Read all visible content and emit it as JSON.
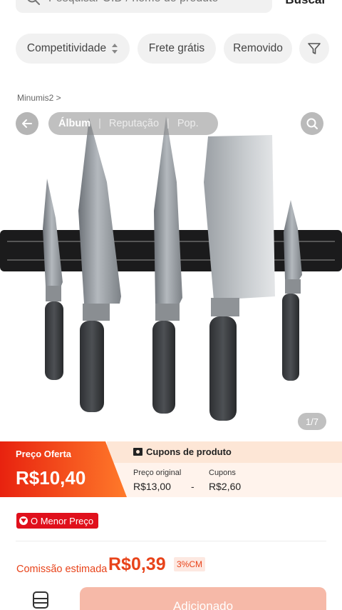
{
  "search": {
    "placeholder": "Pesquisar OID / nome do produto",
    "button_label": "Buscar"
  },
  "filters": {
    "chips": [
      {
        "label": "Competitividade",
        "icon": "sort-updown-icon"
      },
      {
        "label": "Frete grátis"
      },
      {
        "label": "Removido"
      }
    ],
    "filter_icon": "filter-funnel-icon"
  },
  "background_text": "Minumis2 >",
  "gallery": {
    "tabs": [
      "Álbum",
      "Reputação",
      "Pop."
    ],
    "active_tab": "Álbum",
    "counter": "1/7",
    "image_subject": "knives on magnetic strip"
  },
  "price": {
    "offer_label": "Preço Oferta",
    "offer_price": "R$10,40",
    "coupon_header": "Cupons de produto",
    "original_label": "Preço original",
    "original_value": "R$13,00",
    "minus_sign": "-",
    "coupons_label": "Cupons",
    "coupons_value": "R$2,60"
  },
  "badge": {
    "lowest_price": "O Menor Preço"
  },
  "commission": {
    "label": "Comissão estimada",
    "value": "R$0,39",
    "percent": "3%CM"
  },
  "bottom": {
    "add_label": "Adicionado",
    "store_icon": "store-icon"
  },
  "colors": {
    "accent": "#e8431a",
    "offer_gradient_start": "#e8220f",
    "offer_gradient_end": "#ff7a2a",
    "badge_red": "#e0101c",
    "add_button": "#f6b9a8"
  }
}
